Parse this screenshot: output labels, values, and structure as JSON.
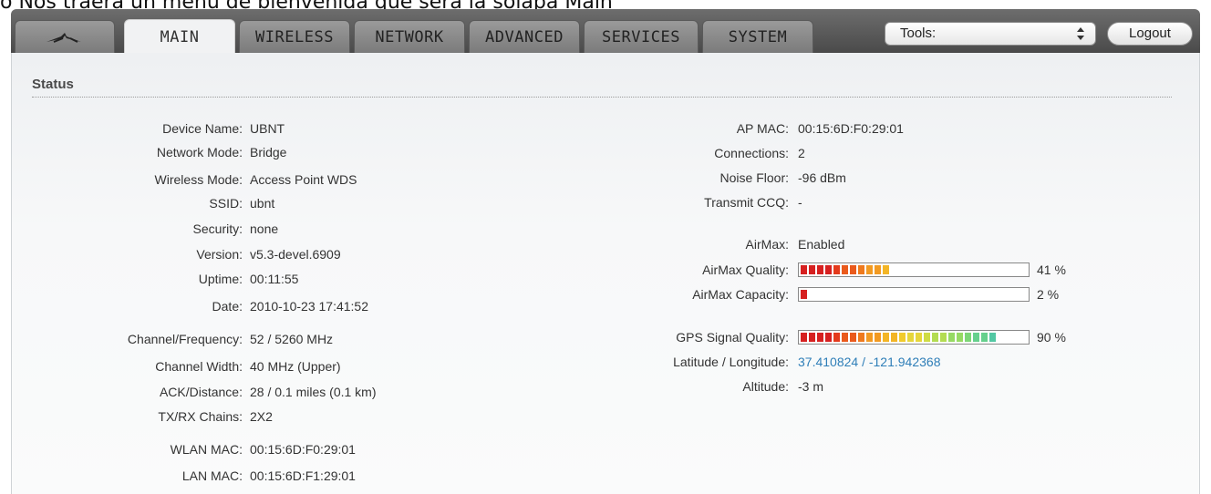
{
  "caption": "o Nos traerá un menú de bienvenida que será la solapa Main",
  "tabs": [
    {
      "label": "MAIN"
    },
    {
      "label": "WIRELESS"
    },
    {
      "label": "NETWORK"
    },
    {
      "label": "ADVANCED"
    },
    {
      "label": "SERVICES"
    },
    {
      "label": "SYSTEM"
    }
  ],
  "tools": {
    "value": "Tools:"
  },
  "logout_label": "Logout",
  "status": {
    "title": "Status",
    "left": [
      {
        "label": "Device Name:",
        "value": "UBNT"
      },
      {
        "label": "Network Mode:",
        "value": "Bridge"
      },
      {
        "label": "Wireless Mode:",
        "value": "Access Point WDS"
      },
      {
        "label": "SSID:",
        "value": "ubnt"
      },
      {
        "label": "Security:",
        "value": "none"
      },
      {
        "label": "Version:",
        "value": "v5.3-devel.6909"
      },
      {
        "label": "Uptime:",
        "value": "00:11:55"
      },
      {
        "label": "Date:",
        "value": "2010-10-23 17:41:52"
      },
      {
        "label": "Channel/Frequency:",
        "value": "52 / 5260 MHz"
      },
      {
        "label": "Channel Width:",
        "value": "40 MHz (Upper)"
      },
      {
        "label": "ACK/Distance:",
        "value": "28 / 0.1 miles (0.1 km)"
      },
      {
        "label": "TX/RX Chains:",
        "value": "2X2"
      },
      {
        "label": "WLAN MAC:",
        "value": "00:15:6D:F0:29:01"
      },
      {
        "label": "LAN MAC:",
        "value": "00:15:6D:F1:29:01"
      }
    ],
    "right": [
      {
        "label": "AP MAC:",
        "value": "00:15:6D:F0:29:01"
      },
      {
        "label": "Connections:",
        "value": "2"
      },
      {
        "label": "Noise Floor:",
        "value": "-96 dBm"
      },
      {
        "label": "Transmit CCQ:",
        "value": "-"
      },
      {
        "label": "AirMax:",
        "value": "Enabled"
      },
      {
        "label": "AirMax Quality:",
        "percent": "41 %",
        "level": 41
      },
      {
        "label": "AirMax Capacity:",
        "percent": "2 %",
        "level": 2
      },
      {
        "label": "GPS Signal Quality:",
        "percent": "90 %",
        "level": 90
      },
      {
        "label": "Latitude / Longitude:",
        "value": "37.410824 / -121.942368"
      },
      {
        "label": "Altitude:",
        "value": "-3 m"
      }
    ]
  }
}
